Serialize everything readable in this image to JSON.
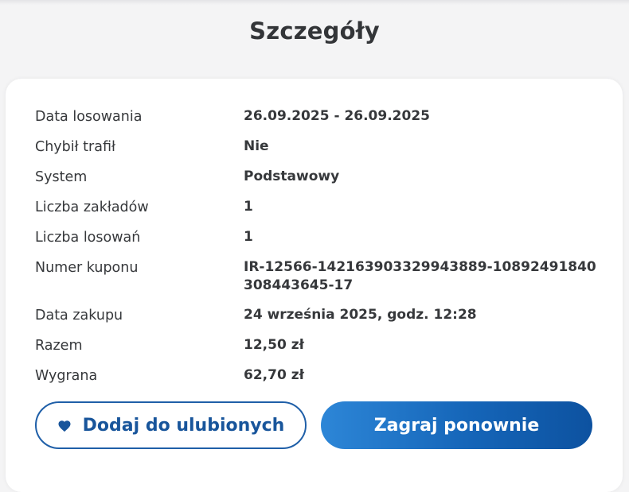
{
  "header": {
    "title": "Szczegóły"
  },
  "details": [
    {
      "label": "Data losowania",
      "value": "26.09.2025 - 26.09.2025"
    },
    {
      "label": "Chybił trafił",
      "value": "Nie"
    },
    {
      "label": "System",
      "value": "Podstawowy"
    },
    {
      "label": "Liczba zakładów",
      "value": "1"
    },
    {
      "label": "Liczba losowań",
      "value": "1"
    },
    {
      "label": "Numer kuponu",
      "value": "IR-12566-142163903329943889-10892491840308443645-17"
    },
    {
      "label": "Data zakupu",
      "value": "24 września 2025, godz. 12:28"
    },
    {
      "label": "Razem",
      "value": "12,50 zł"
    },
    {
      "label": "Wygrana",
      "value": "62,70 zł"
    }
  ],
  "actions": {
    "favorite_label": "Dodaj do ulubionych",
    "favorite_icon": "heart-icon",
    "play_again_label": "Zagraj ponownie"
  },
  "colors": {
    "primary": "#1565b8",
    "background": "#f4f4f5",
    "card": "#ffffff",
    "text": "#36383b"
  }
}
